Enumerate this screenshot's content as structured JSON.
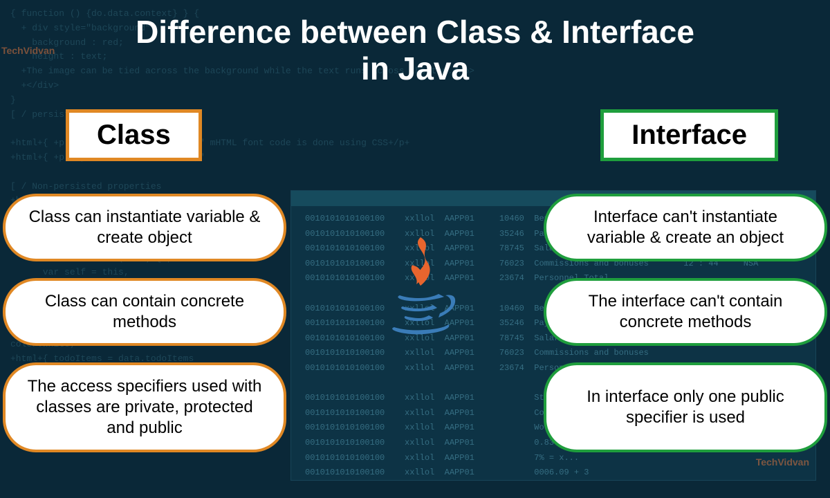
{
  "title_line1": "Difference between Class & Interface",
  "title_line2": "in Java",
  "columns": {
    "class": {
      "header": "Class",
      "points": [
        "Class can instantiate variable & create object",
        "Class can contain concrete methods",
        "The access specifiers used with classes are private, protected and public"
      ],
      "accent_color": "#e08824"
    },
    "interface": {
      "header": "Interface",
      "points": [
        "Interface can't instantiate variable & create an object",
        "The interface can't contain concrete methods",
        "In interface only one public specifier is used"
      ],
      "accent_color": "#1f9e3d"
    }
  },
  "watermark_text": "TechVidvan",
  "bg_code_snippet": "{ function () {do.data.context} } {\n  + div style=\"background\"\n    background : red;\n    height : text;\n  +The image can be tied across the background while the text runs across the top.</p>\n  +</div>\n}\n[ / persisted properties\n\n+html+{ +p style=\"font-weight:bold;\" mHTML font code is done using CSS+/p+\n+html+{ +p style=\"font-color:white;\"\n\n[ / Non-persisted properties\n+html = data.readonly\n\n+p style=\"font-weight:bold;\" mHTML font g CSS+/p+\n\n   function todoItem(todo) { ,\n      var self = this,\n      data = dta }..,\n\n\n\ncolor:white;\"\n+html+{ todoItems = data.todoItems",
  "bg_window_snippet": "0010101010100100    xxllol  AAPP01     10460  Benefits\n0010101010100100    xxllol  AAPP01     35246  Payroll taxes\n0010101010100100    xxllol  AAPP01     78745  Salaries\n0010101010100100    xxllol  AAPP01     76023  Commissions and bonuses       12 : 44     NSA\n0010101010100100    xxllol  AAPP01     23674  Personnel Total\n\n0010101010100100    xxllol  AAPP01     10460  Benefits\n0010101010100100    xxllol  AAPP01     35246  Payroll taxes\n0010101010100100    xxllol  AAPP01     78745  Salaries\n0010101010100100    xxllol  AAPP01     76023  Commissions and bonuses\n0010101010100100    xxllol  AAPP01     23674  Personnel Total               13 : 32     NSA\n\n0010101010100100    xxllol  AAPP01            Stocks Exchange\n0010101010100100    xxllol  AAPP01            Company ( xx...\n0010101010100100    xxllol  AAPP01            Worminuud  coll\n0010101010100100    xxllol  AAPP01            0.8374%/7l\n0010101010100100    xxllol  AAPP01            7% = x...\n0010101010100100    xxllol  AAPP01            0006.09 + 3"
}
